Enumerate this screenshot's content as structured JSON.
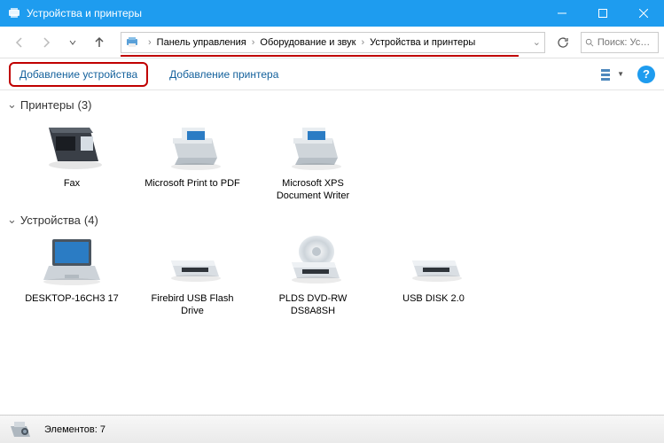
{
  "window": {
    "title": "Устройства и принтеры"
  },
  "breadcrumb": {
    "part1": "Панель управления",
    "part2": "Оборудование и звук",
    "part3": "Устройства и принтеры"
  },
  "search": {
    "placeholder": "Поиск: Ус…"
  },
  "toolbar": {
    "add_device": "Добавление устройства",
    "add_printer": "Добавление принтера"
  },
  "sections": {
    "printers": {
      "title": "Принтеры",
      "count": "(3)"
    },
    "devices": {
      "title": "Устройства",
      "count": "(4)"
    }
  },
  "printers": [
    {
      "label": "Fax"
    },
    {
      "label": "Microsoft Print to PDF"
    },
    {
      "label": "Microsoft XPS Document Writer"
    }
  ],
  "devices": [
    {
      "label": "DESKTOP-16CH3 17"
    },
    {
      "label": "Firebird USB Flash Drive"
    },
    {
      "label": "PLDS DVD-RW DS8A8SH"
    },
    {
      "label": "USB DISK 2.0"
    }
  ],
  "status": {
    "text": "Элементов: 7"
  }
}
